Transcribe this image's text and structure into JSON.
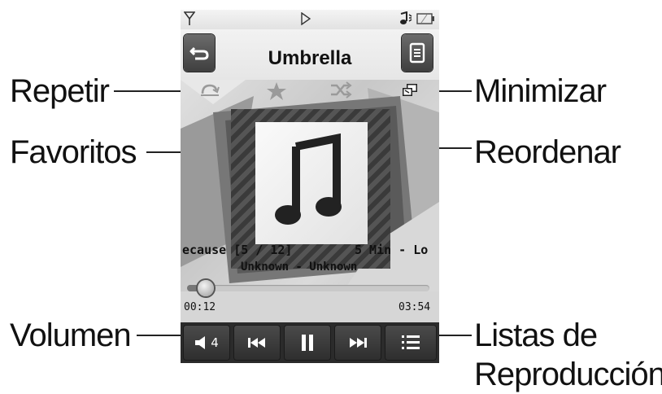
{
  "player": {
    "title": "Umbrella",
    "track_info": "ecause  [5 / 12]",
    "track_info_right": "5 Min - Lo",
    "artist_album": "Unknown - Unknown",
    "elapsed": "00:12",
    "total": "03:54",
    "progress": 0.05,
    "volume_level": "4"
  },
  "callouts": {
    "repeat": "Repetir",
    "favorites": "Favoritos",
    "volume": "Volumen",
    "minimize": "Minimizar",
    "shuffle": "Reordenar",
    "playlists_line1": "Listas de",
    "playlists_line2": "Reproducción"
  },
  "icons": {
    "back": "back-arrow-icon",
    "menu": "menu-icon",
    "repeat": "repeat-icon",
    "favorite": "star-icon",
    "shuffle": "shuffle-icon",
    "minimize": "minimize-icon",
    "album_art": "music-note-icon",
    "volume": "speaker-icon",
    "prev": "previous-track-icon",
    "pause": "pause-icon",
    "next": "next-track-icon",
    "playlist": "playlist-icon"
  },
  "colors": {
    "control_bar": "#2b2b2b",
    "button": "#4a4a4a",
    "icon_tint": "#999999"
  }
}
